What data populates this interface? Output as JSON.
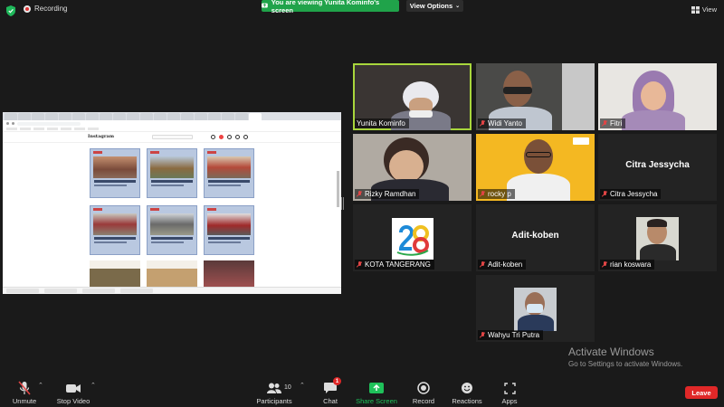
{
  "header": {
    "recording_label": "Recording",
    "viewing_banner": "You are viewing Yunita Kominfo's screen",
    "view_options_label": "View Options",
    "view_label": "View"
  },
  "shared_screen": {
    "site_logo": "Instagram"
  },
  "participants": [
    {
      "name": "Yunita Kominfo",
      "muted": false,
      "speaking": true,
      "video": true
    },
    {
      "name": "Widi Yanto",
      "muted": true,
      "speaking": false,
      "video": true
    },
    {
      "name": "Fitri",
      "muted": true,
      "speaking": false,
      "video": true
    },
    {
      "name": "Rizky Ramdhan",
      "muted": true,
      "speaking": false,
      "video": true
    },
    {
      "name": "rocky p",
      "muted": true,
      "speaking": false,
      "video": true
    },
    {
      "name": "Citra Jessycha",
      "muted": true,
      "speaking": false,
      "video": false,
      "center_name": "Citra Jessycha"
    },
    {
      "name": "KOTA TANGERANG",
      "muted": true,
      "speaking": false,
      "video": true
    },
    {
      "name": "Adit-koben",
      "muted": true,
      "speaking": false,
      "video": false,
      "center_name": "Adit-koben"
    },
    {
      "name": "rian koswara",
      "muted": true,
      "speaking": false,
      "video": true
    },
    {
      "name": "Wahyu Tri Putra",
      "muted": true,
      "speaking": false,
      "video": true
    }
  ],
  "watermark": {
    "title": "Activate Windows",
    "subtitle": "Go to Settings to activate Windows."
  },
  "toolbar": {
    "unmute": "Unmute",
    "stop_video": "Stop Video",
    "participants": "Participants",
    "participants_count": "10",
    "chat": "Chat",
    "chat_badge": "1",
    "share_screen": "Share Screen",
    "record": "Record",
    "reactions": "Reactions",
    "apps": "Apps",
    "leave": "Leave"
  },
  "colors": {
    "share_green": "#20a34a",
    "leave_red": "#e02828",
    "active_speaker": "#a8d63c"
  }
}
